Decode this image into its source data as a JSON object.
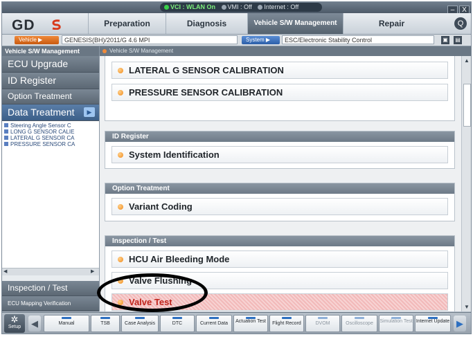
{
  "status_bar": {
    "items": [
      {
        "label": "VCI : WLAN On",
        "state": "on"
      },
      {
        "label": "VMI : Off",
        "state": "off"
      },
      {
        "label": "Internet : Off",
        "state": "off"
      }
    ],
    "minimize_label": "–",
    "close_label": "X"
  },
  "brand": {
    "logo_text": "GD"
  },
  "top_nav": {
    "tabs": [
      {
        "label": "Preparation"
      },
      {
        "label": "Diagnosis"
      },
      {
        "label": "Vehicle S/W Management"
      },
      {
        "label": "Repair"
      }
    ],
    "help_label": "Q"
  },
  "vehicle_bar": {
    "vehicle_button": "Vehicle",
    "vehicle_value": "GENESIS(BH)/2011/G 4.6 MPI",
    "system_button": "System",
    "system_value": "ESC/Electronic Stability Control"
  },
  "sidebar": {
    "header": "Vehicle S/W Management",
    "items": [
      {
        "label": "ECU Upgrade"
      },
      {
        "label": "ID Register"
      },
      {
        "label": "Option Treatment"
      },
      {
        "label": "Data Treatment"
      }
    ],
    "list": [
      "Steering Angle Sensor C",
      "LONG G SENSOR CALIE",
      "LATERAL G SENSOR CA",
      "PRESSURE SENSOR CA"
    ],
    "bottom_items": [
      {
        "label": "Inspection / Test"
      },
      {
        "label": "ECU Mapping Verification"
      }
    ]
  },
  "main": {
    "header": "Vehicle S/W Management",
    "top_items": [
      "LATERAL G SENSOR CALIBRATION",
      "PRESSURE SENSOR CALIBRATION"
    ],
    "groups": [
      {
        "title": "ID Register",
        "items": [
          "System Identification"
        ]
      },
      {
        "title": "Option Treatment",
        "items": [
          "Variant Coding"
        ]
      },
      {
        "title": "Inspection / Test",
        "items": [
          "HCU Air Bleeding Mode",
          "Valve Flushing",
          "Valve Test"
        ]
      }
    ]
  },
  "toolbar": {
    "setup_label": "Setup",
    "buttons": [
      {
        "label": "Manual",
        "enabled": true
      },
      {
        "label": "TSB",
        "enabled": true
      },
      {
        "label": "Case Analysis",
        "enabled": true
      },
      {
        "label": "DTC",
        "enabled": true
      },
      {
        "label": "Current Data",
        "enabled": true
      },
      {
        "label": "Actuation Test",
        "enabled": true
      },
      {
        "label": "Flight Record",
        "enabled": true
      },
      {
        "label": "DVOM",
        "enabled": false
      },
      {
        "label": "Oscilloscope",
        "enabled": false
      },
      {
        "label": "Simulation Test",
        "enabled": false
      },
      {
        "label": "Internet Update",
        "enabled": true
      }
    ]
  },
  "colors": {
    "accent_orange": "#f08a3a",
    "highlight_red": "#c0241c",
    "active_tab": "#56636f"
  }
}
